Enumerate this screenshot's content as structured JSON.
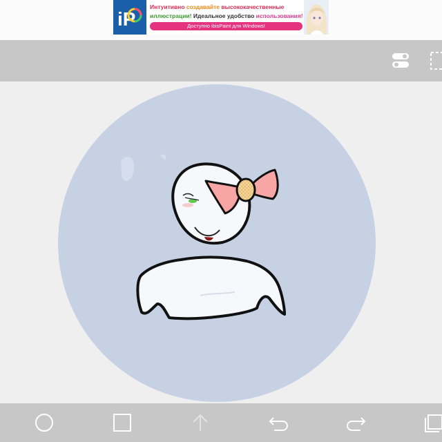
{
  "ad": {
    "logo_text": "iP",
    "line1": [
      {
        "text": "Интуитивно ",
        "color": "#e02c55"
      },
      {
        "text": "создавайте ",
        "color": "#f08a16"
      },
      {
        "text": "высококачественные",
        "color": "#e02c55"
      }
    ],
    "line2": [
      {
        "text": "иллюстрации! ",
        "color": "#3d9a2e"
      },
      {
        "text": "Идеальное удобство ",
        "color": "#333333"
      },
      {
        "text": "использования!",
        "color": "#e03a8c"
      }
    ],
    "cta": "Доступно ibisPaint для Windows!"
  },
  "toolbar": {
    "icons": [
      "toggle-switch-icon",
      "selection-frame-icon"
    ]
  },
  "bottom_bar": {
    "buttons": [
      {
        "name": "ellipse-tool-button",
        "icon": "circle-icon"
      },
      {
        "name": "rectangle-tool-button",
        "icon": "square-icon"
      },
      {
        "name": "up-arrow-button",
        "icon": "up-arrow-icon"
      },
      {
        "name": "undo-button",
        "icon": "undo-icon"
      },
      {
        "name": "redo-button",
        "icon": "redo-icon"
      },
      {
        "name": "layers-button",
        "icon": "layers-icon"
      }
    ]
  },
  "colors": {
    "toolbar_bg": "#c7c7c7",
    "canvas_bg": "#efefef",
    "circle_fill": "#c7d1e4",
    "bow_pink": "#f7a5a5",
    "bow_knot": "#f6d9a0"
  }
}
